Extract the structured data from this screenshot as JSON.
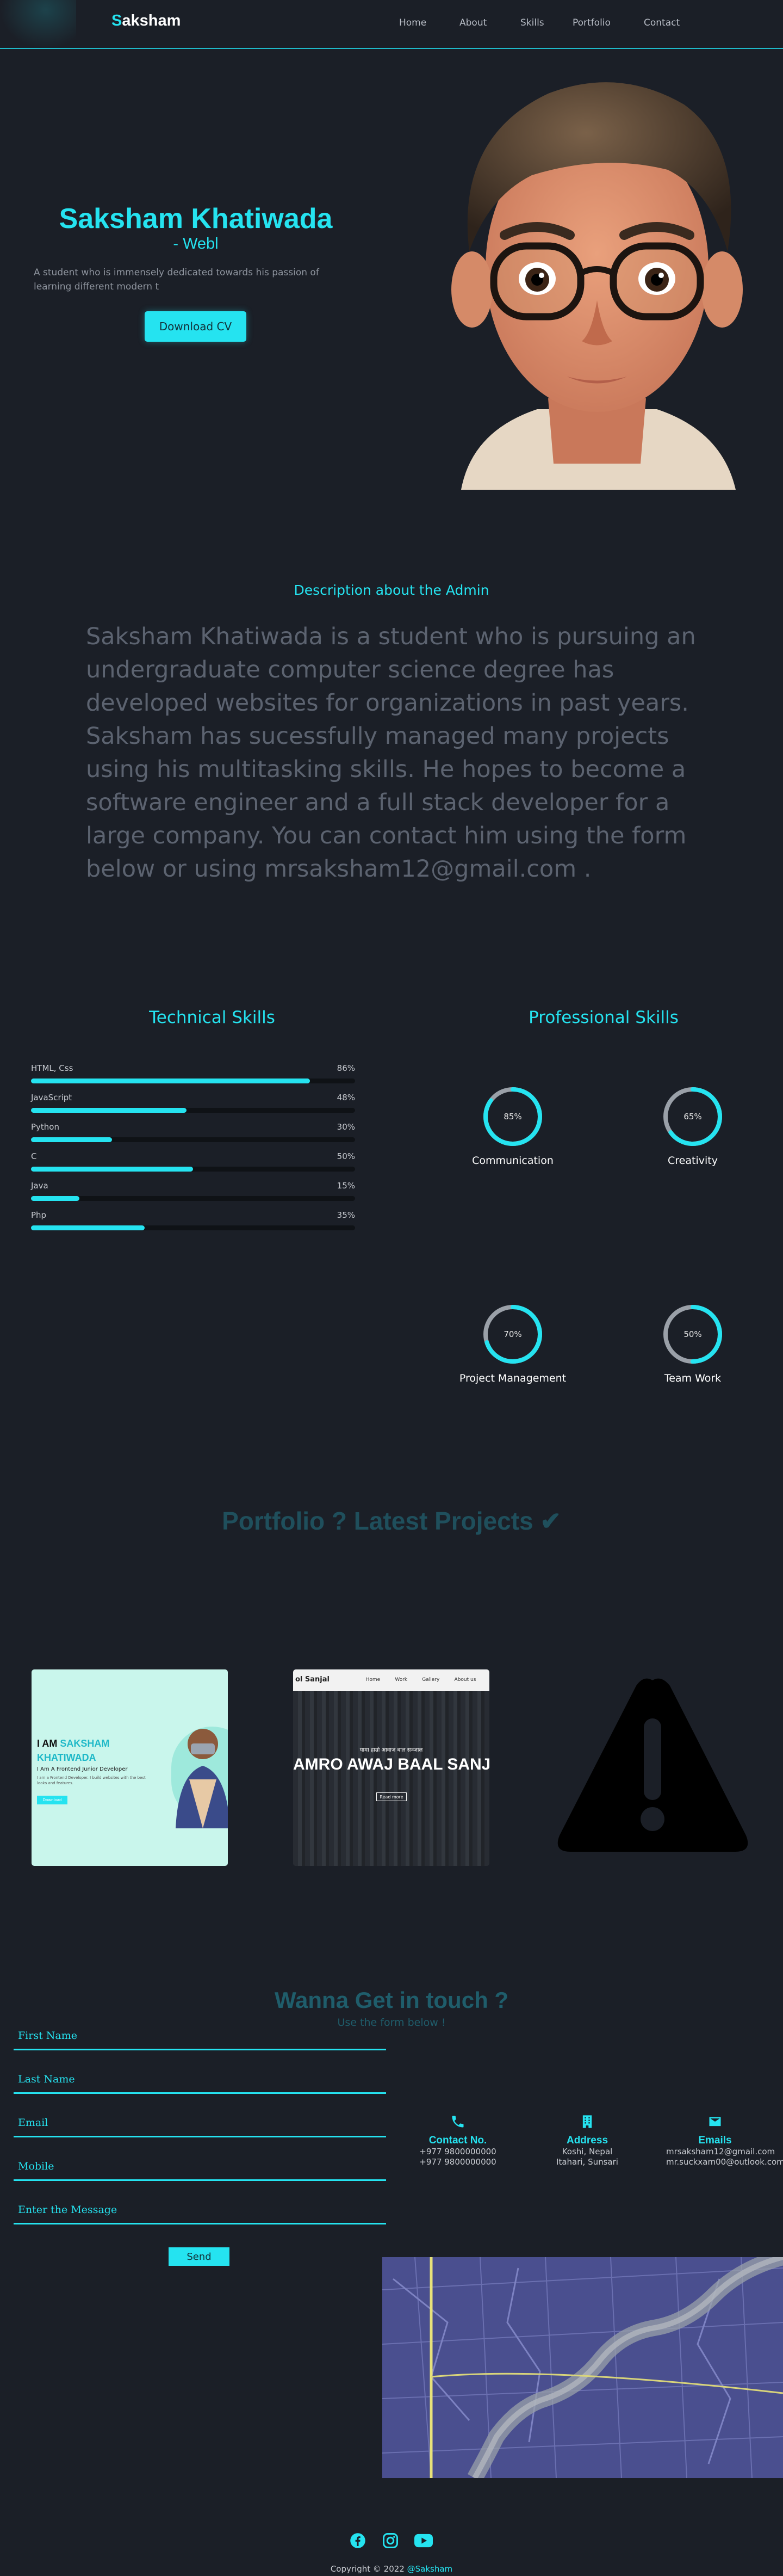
{
  "header": {
    "logo_initial": "S",
    "logo_rest": "aksham",
    "nav": [
      "Home",
      "About",
      "Skills",
      "Portfolio",
      "Contact"
    ]
  },
  "hero": {
    "name": "Saksham Khatiwada",
    "role": "- Webl",
    "description": "A student who is immensely dedicated towards his passion of learning different modern t",
    "cv_button": "Download CV"
  },
  "about": {
    "title": "Description about the Admin",
    "text": "Saksham Khatiwada is a student who is pursuing an undergraduate computer science degree has developed websites for organizations in past years. Saksham has sucessfully managed many projects using his multitasking skills. He hopes to become a software engineer and a full stack developer for a large company. You can contact him using the form below or using mrsaksham12@gmail.com ."
  },
  "technical_skills": {
    "title": "Technical Skills",
    "items": [
      {
        "name": "HTML, Css",
        "label": "86%",
        "value": 0.86
      },
      {
        "name": "JavaScript",
        "label": "48%",
        "value": 0.48
      },
      {
        "name": "Python",
        "label": "30%",
        "value": 0.25
      },
      {
        "name": "C",
        "label": "50%",
        "value": 0.5
      },
      {
        "name": "Java",
        "label": "15%",
        "value": 0.15
      },
      {
        "name": "Php",
        "label": "35%",
        "value": 0.35
      }
    ]
  },
  "professional_skills": {
    "title": "Professional Skills",
    "items": [
      {
        "name": "Communication",
        "label": "85%",
        "value": 0.85
      },
      {
        "name": "Creativity",
        "label": "65%",
        "value": 0.65
      },
      {
        "name": "Project Management",
        "label": "70%",
        "value": 0.7
      },
      {
        "name": "Team Work",
        "label": "50%",
        "value": 0.5
      }
    ]
  },
  "portfolio": {
    "title": "Portfolio ? Latest Projects ✔",
    "project1": {
      "i_am": "I AM",
      "name_1": "SAKSHAM",
      "name_2": "KHATIWADA",
      "tagline": "I Am A Frontend Junior Developer",
      "blurb": "I am a Frontend Developer. I build websites with the best looks and features.",
      "button": "Download"
    },
    "project2": {
      "brand": "ol Sanjal",
      "nav": [
        "Home",
        "Work",
        "Gallery",
        "About us"
      ],
      "small_heading": "यामा हाम्रो आवाज बाल सञ्जाल",
      "banner": "AMRO AWAJ BAAL SANJ",
      "sub": "Read more"
    },
    "project3": {
      "icon": "warning-icon"
    }
  },
  "contact": {
    "title": "Wanna Get in touch ?",
    "subtitle": "Use the form below !",
    "fields": [
      "First Name",
      "Last Name",
      "Email",
      "Mobile",
      "Enter the Message"
    ],
    "send": "Send",
    "info": [
      {
        "icon": "phone-icon",
        "title": "Contact No.",
        "lines": [
          "+977 9800000000",
          "+977 9800000000"
        ]
      },
      {
        "icon": "building-icon",
        "title": "Address",
        "lines": [
          "Koshi, Nepal",
          "Itahari, Sunsari"
        ]
      },
      {
        "icon": "mail-icon",
        "title": "Emails",
        "lines": [
          "mrsaksham12@gmail.com",
          "mr.suckxam00@outlook.com"
        ]
      }
    ]
  },
  "footer": {
    "icons": [
      "facebook-icon",
      "instagram-icon",
      "youtube-icon"
    ],
    "copyright": "Copyright © 2022",
    "handle": "@Saksham"
  },
  "colors": {
    "accent": "#25e3f0",
    "background": "#1b1f27",
    "muted": "#5c6370"
  }
}
